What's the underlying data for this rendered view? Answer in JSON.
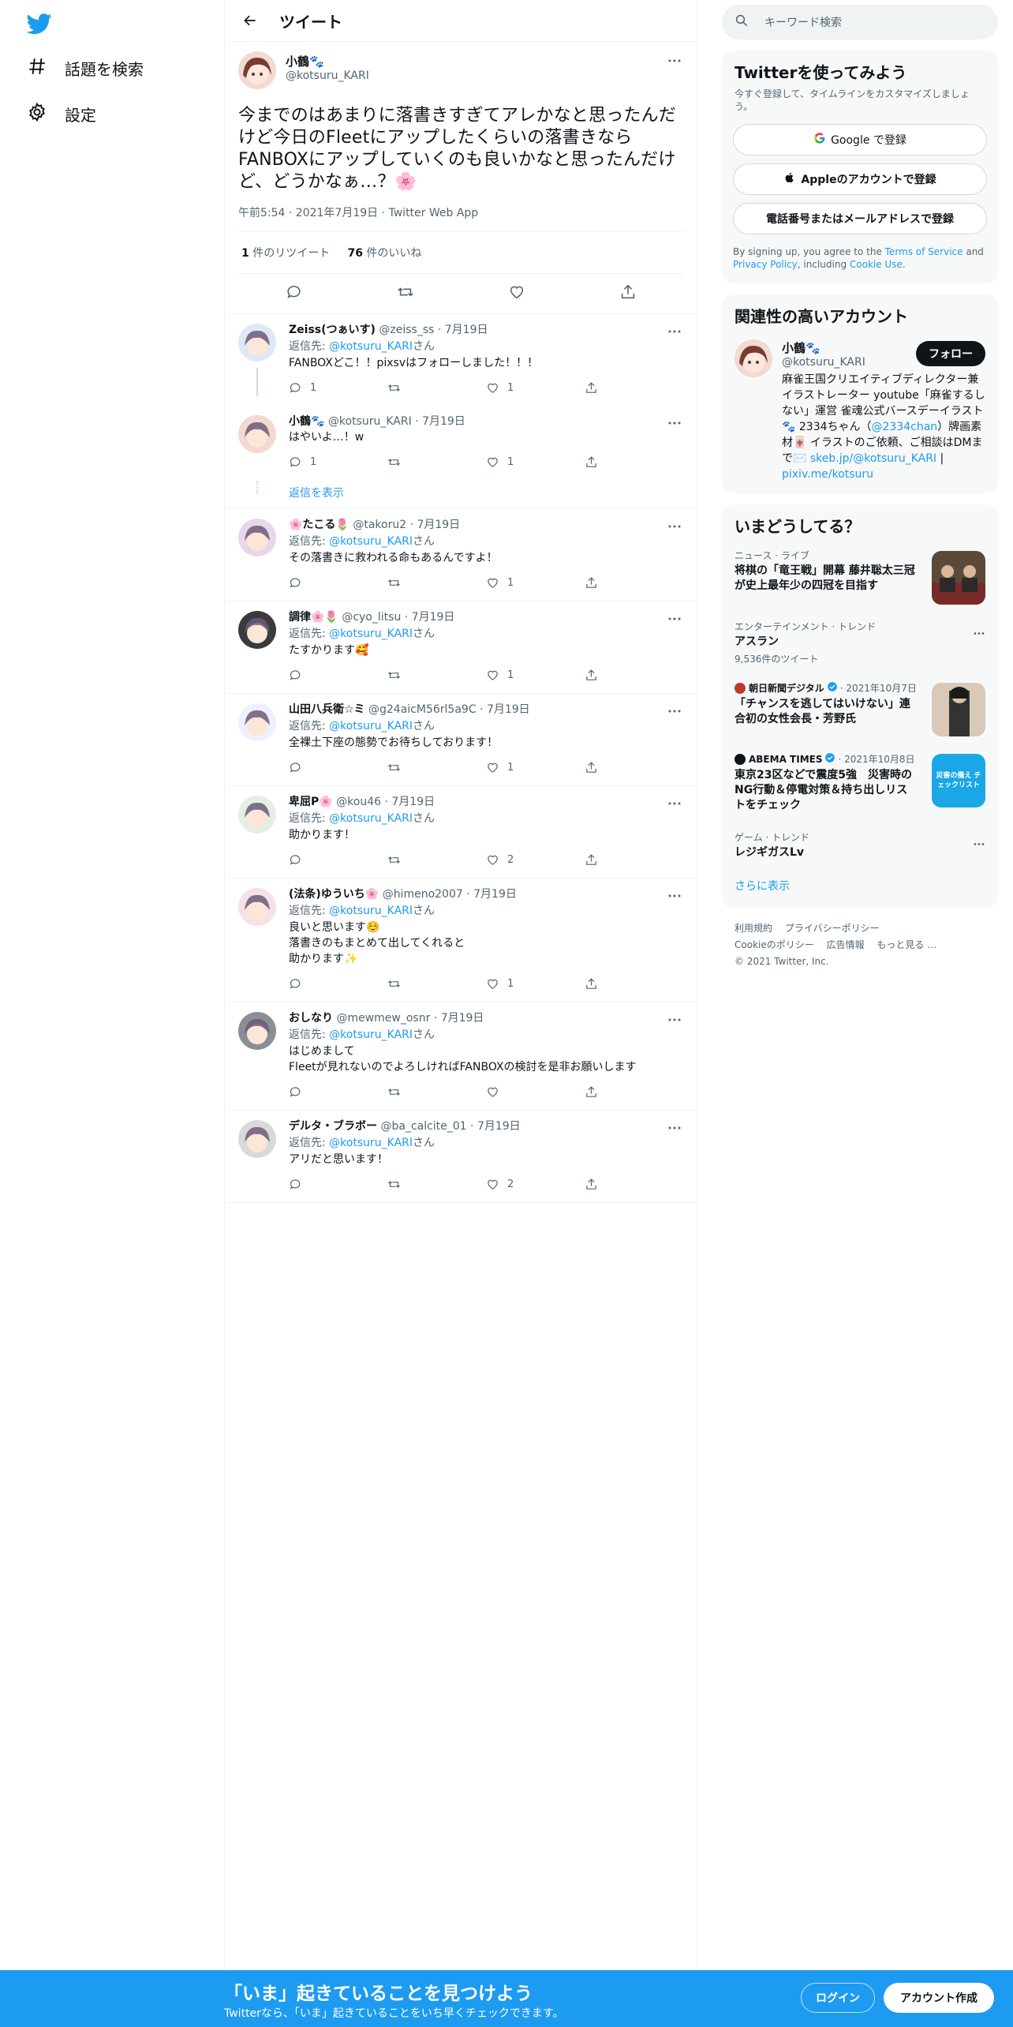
{
  "nav": {
    "explore_label": "話題を検索",
    "settings_label": "設定"
  },
  "header": {
    "title": "ツイート"
  },
  "tweet": {
    "name": "小鶴🐾",
    "handle": "@kotsuru_KARI",
    "text": "今までのはあまりに落書きすぎてアレかなと思ったんだけど今日のFleetにアップしたくらいの落書きならFANBOXにアップしていくのも良いかなと思ったんだけど、どうかなぁ…？🌸",
    "meta": "午前5:54 · 2021年7月19日 · Twitter Web App",
    "retweets": "1",
    "retweets_label": "件のリツイート",
    "likes": "76",
    "likes_label": "件のいいね"
  },
  "reply_prefix": "返信先: ",
  "reply_suffix": "さん",
  "show_replies": "返信を表示",
  "replies": [
    {
      "name": "Zeiss(つぁいす)",
      "handle": "@zeiss_ss",
      "date": "· 7月19日",
      "replyto": "@kotsuru_KARI",
      "text": [
        "FANBOXどこ！！pixsvはフォローしました！！！"
      ],
      "replies": "1",
      "retweets": "",
      "likes": "1"
    },
    {
      "name": "小鶴🐾",
      "handle": "@kotsuru_KARI",
      "date": "· 7月19日",
      "replyto": "",
      "text": [
        "はやいよ…！w"
      ],
      "replies": "1",
      "retweets": "",
      "likes": "1"
    },
    {
      "name": "🌸たこる🌷",
      "handle": "@takoru2",
      "date": "· 7月19日",
      "replyto": "@kotsuru_KARI",
      "text": [
        "その落書きに救われる命もあるんですよ！"
      ],
      "replies": "",
      "retweets": "",
      "likes": "1"
    },
    {
      "name": "調律🌸🌷",
      "handle": "@cyo_litsu",
      "date": "· 7月19日",
      "replyto": "@kotsuru_KARI",
      "text": [
        "たすかります🥰"
      ],
      "replies": "",
      "retweets": "",
      "likes": "1"
    },
    {
      "name": "山田八兵衛☆ミ",
      "handle": "@g24aicM56rl5a9C",
      "date": "· 7月19日",
      "replyto": "@kotsuru_KARI",
      "text": [
        "全裸土下座の態勢でお待ちしております！"
      ],
      "replies": "",
      "retweets": "",
      "likes": "1"
    },
    {
      "name": "卑屈P🌸",
      "handle": "@kou46",
      "date": "· 7月19日",
      "replyto": "@kotsuru_KARI",
      "text": [
        "助かります！"
      ],
      "replies": "",
      "retweets": "",
      "likes": "2"
    },
    {
      "name": "(法条)ゆういち🌸",
      "handle": "@himeno2007",
      "date": "· 7月19日",
      "replyto": "@kotsuru_KARI",
      "text": [
        "良いと思います☺️",
        "落書きのもまとめて出してくれると",
        "助かります✨"
      ],
      "replies": "",
      "retweets": "",
      "likes": "1"
    },
    {
      "name": "おしなり",
      "handle": "@mewmew_osnr",
      "date": "· 7月19日",
      "replyto": "@kotsuru_KARI",
      "text": [
        "はじめまして",
        "Fleetが見れないのでよろしければFANBOXの検討を是非お願いします"
      ],
      "replies": "",
      "retweets": "",
      "likes": ""
    },
    {
      "name": "デルタ・ブラボー",
      "handle": "@ba_calcite_01",
      "date": "· 7月19日",
      "replyto": "@kotsuru_KARI",
      "text": [
        "アリだと思います！"
      ],
      "replies": "",
      "retweets": "",
      "likes": "2"
    }
  ],
  "right": {
    "search_placeholder": "キーワード検索",
    "signup": {
      "title": "Twitterを使ってみよう",
      "subtitle": "今すぐ登録して、タイムラインをカスタマイズしましょう。",
      "google": "Google で登録",
      "apple": "Appleのアカウントで登録",
      "phone": "電話番号またはメールアドレスで登録",
      "terms_pre": "By signing up, you agree to the ",
      "terms_tos": "Terms of Service",
      "terms_and": " and ",
      "terms_privacy": "Privacy Policy",
      "terms_mid": ", including ",
      "terms_cookie": "Cookie Use",
      "terms_end": "."
    },
    "relevant": {
      "title": "関連性の高いアカウント",
      "name": "小鶴🐾",
      "handle": "@kotsuru_KARI",
      "follow": "フォロー",
      "bio_1": "麻雀王国クリエイティブディレクター兼イラストレーター youtube「麻雀するしない」運営 雀魂公式バースデーイラスト🐾 2334ちゃん（",
      "bio_link1": "@2334chan",
      "bio_2": "）牌画素材🀄 イラストのご依頼、ご相談はDMまで✉️ ",
      "bio_link2": "skeb.jp/@kotsuru_KARI",
      "bio_3": " | ",
      "bio_link3": "pixiv.me/kotsuru"
    },
    "trends": {
      "title": "いまどうしてる？",
      "items": [
        {
          "ctx": "ニュース · ライブ",
          "title": "将棋の「竜王戦」開幕 藤井聡太三冠が史上最年少の四冠を目指す"
        },
        {
          "ctx": "エンターテインメント · トレンド",
          "title": "アスラン",
          "count": "9,536件のツイート"
        },
        {
          "src": "朝日新聞デジタル",
          "date": "· 2021年10月7日",
          "title": "「チャンスを逃してはいけない」連合初の女性会長・芳野氏"
        },
        {
          "src": "ABEMA TIMES",
          "date": "· 2021年10月8日",
          "title": "東京23区などで震度5強　災害時のNG行動＆停電対策＆持ち出しリストをチェック",
          "thumb_text": "災害の備え チェックリスト"
        },
        {
          "ctx": "ゲーム · トレンド",
          "title": "レジギガスLv"
        }
      ],
      "more": "さらに表示"
    },
    "footer": {
      "terms": "利用規約",
      "privacy": "プライバシーポリシー",
      "cookie": "Cookieのポリシー",
      "ads": "広告情報",
      "more": "もっと見る …",
      "copyright": "© 2021 Twitter, Inc."
    }
  },
  "banner": {
    "title": "「いま」起きていることを見つけよう",
    "subtitle": "Twitterなら、「いま」起きていることをいち早くチェックできます。",
    "login": "ログイン",
    "signup": "アカウント作成"
  },
  "colors": {
    "accent": "#1d9bf0",
    "text": "#0f1419",
    "secondary": "#536471"
  }
}
